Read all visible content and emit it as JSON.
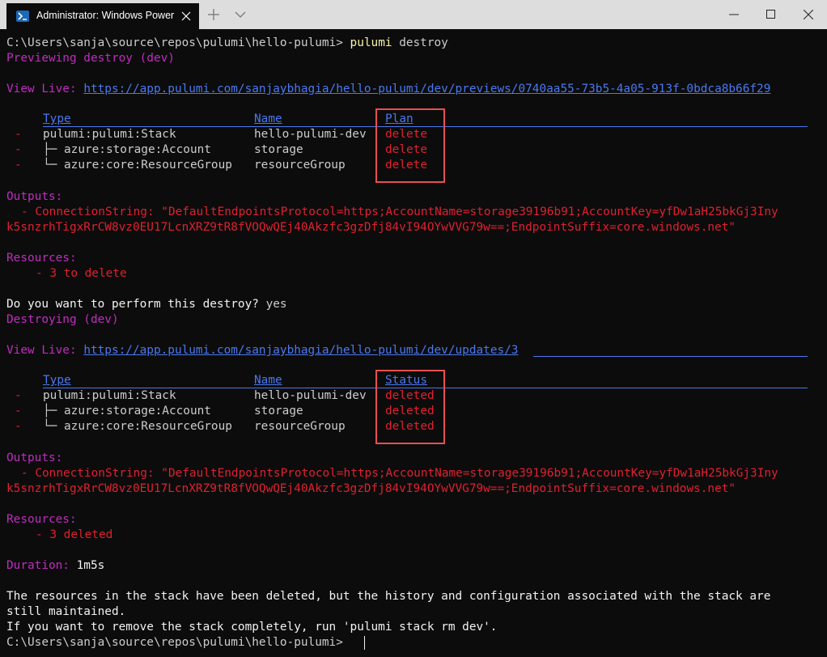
{
  "titlebar": {
    "tab_title": "Administrator: Windows PowerShell"
  },
  "colors": {
    "background": "#0c0c0c",
    "titlebar": "#dddddd",
    "magenta": "#c02cc0",
    "red": "#e02030",
    "link_blue": "#4a78f0",
    "highlight_box": "#e8504f"
  },
  "terminal": {
    "prompt": "C:\\Users\\sanja\\source\\repos\\pulumi\\hello-pulumi>",
    "command_exe": "pulumi",
    "command_args": " destroy",
    "preview_line": "Previewing destroy (dev)",
    "view_live_label": "View Live:",
    "preview_url": "https://app.pulumi.com/sanjaybhagia/hello-pulumi/dev/previews/0740aa55-73b5-4a05-913f-0bdca8b66f29",
    "preview_table": {
      "headers": {
        "type": "Type",
        "name": "Name",
        "plan": "Plan"
      },
      "rows": [
        {
          "marker": "-",
          "type": "pulumi:pulumi:Stack",
          "name": "hello-pulumi-dev",
          "plan": "delete"
        },
        {
          "marker": "-",
          "type": "├─ azure:storage:Account",
          "name": "storage",
          "plan": "delete"
        },
        {
          "marker": "-",
          "type": "└─ azure:core:ResourceGroup",
          "name": "resourceGroup",
          "plan": "delete"
        }
      ]
    },
    "outputs_label": "Outputs:",
    "connection_line_1": "- ConnectionString: \"DefaultEndpointsProtocol=https;AccountName=storage39196b91;AccountKey=yfDw1aH25bkGj3Iny",
    "connection_line_2": "k5snzrhTigxRrCW8vz0EU17LcnXRZ9tR8fVOQwQEj40Akzfc3gzDfj84vI94OYwVVG79w==;EndpointSuffix=core.windows.net\"",
    "resources_label": "Resources:",
    "to_delete": "- 3 to delete",
    "confirm_question": "Do you want to perform this destroy?",
    "confirm_answer": " yes",
    "destroying_line": "Destroying (dev)",
    "update_url": "https://app.pulumi.com/sanjaybhagia/hello-pulumi/dev/updates/3",
    "update_table": {
      "headers": {
        "type": "Type",
        "name": "Name",
        "status": "Status"
      },
      "rows": [
        {
          "marker": "-",
          "type": "pulumi:pulumi:Stack",
          "name": "hello-pulumi-dev",
          "status": "deleted"
        },
        {
          "marker": "-",
          "type": "├─ azure:storage:Account",
          "name": "storage",
          "status": "deleted"
        },
        {
          "marker": "-",
          "type": "└─ azure:core:ResourceGroup",
          "name": "resourceGroup",
          "status": "deleted"
        }
      ]
    },
    "deleted_count": "- 3 deleted",
    "duration_label": "Duration:",
    "duration_value": " 1m5s",
    "final_message_1": "The resources in the stack have been deleted, but the history and configuration associated with the stack are",
    "final_message_2": "still maintained.",
    "final_message_3": "If you want to remove the stack completely, run 'pulumi stack rm dev'."
  },
  "icons": {
    "tab": "powershell-icon",
    "close_tab": "close-icon",
    "new_tab": "plus-icon",
    "dropdown": "chevron-down-icon",
    "minimize": "minimize-icon",
    "maximize": "maximize-icon",
    "close_window": "close-icon"
  }
}
